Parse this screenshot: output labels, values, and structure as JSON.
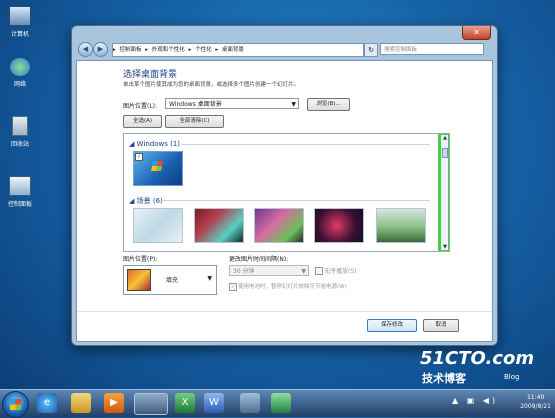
{
  "desktop": {
    "icons": [
      {
        "label": "计算机"
      },
      {
        "label": "网络"
      },
      {
        "label": "回收站"
      },
      {
        "label": "控制面板"
      }
    ]
  },
  "window": {
    "close_glyph": "✕",
    "back_glyph": "◀",
    "forward_glyph": "▶",
    "refresh_glyph": "↻",
    "breadcrumb": [
      "控制面板",
      "外观和个性化",
      "个性化",
      "桌面背景"
    ],
    "breadcrumb_sep": "▸",
    "search_placeholder": "搜索控制面板"
  },
  "content": {
    "title": "选择桌面背景",
    "description": "单击某个图片使其成为您的桌面背景，或选择多个图片创建一个幻灯片。",
    "location_label": "图片位置(L):",
    "location_value": "Windows 桌面背景",
    "browse_label": "浏览(B)...",
    "select_all_label": "全选(A)",
    "clear_all_label": "全部清除(C)",
    "groups": [
      {
        "name": "Windows (1)"
      },
      {
        "name": "场景 (6)"
      }
    ],
    "windows_checked_glyph": "✓",
    "position_label": "图片位置(P):",
    "position_value": "填充",
    "interval_label": "更改图片时间间隔(N):",
    "interval_value": "30 分钟",
    "shuffle_label": "无序播放(S)",
    "battery_label": "使用电池时，暂停幻灯片放映可节省电源(W)",
    "save_label": "保存修改",
    "cancel_label": "取消"
  },
  "taskbar": {
    "tray_icons": "▲ ▣ ◀)",
    "time": "11:40",
    "date": "2009/8/21"
  },
  "watermark": {
    "site": "51CTO.com",
    "cn": "技术博客",
    "blog": "Blog"
  }
}
